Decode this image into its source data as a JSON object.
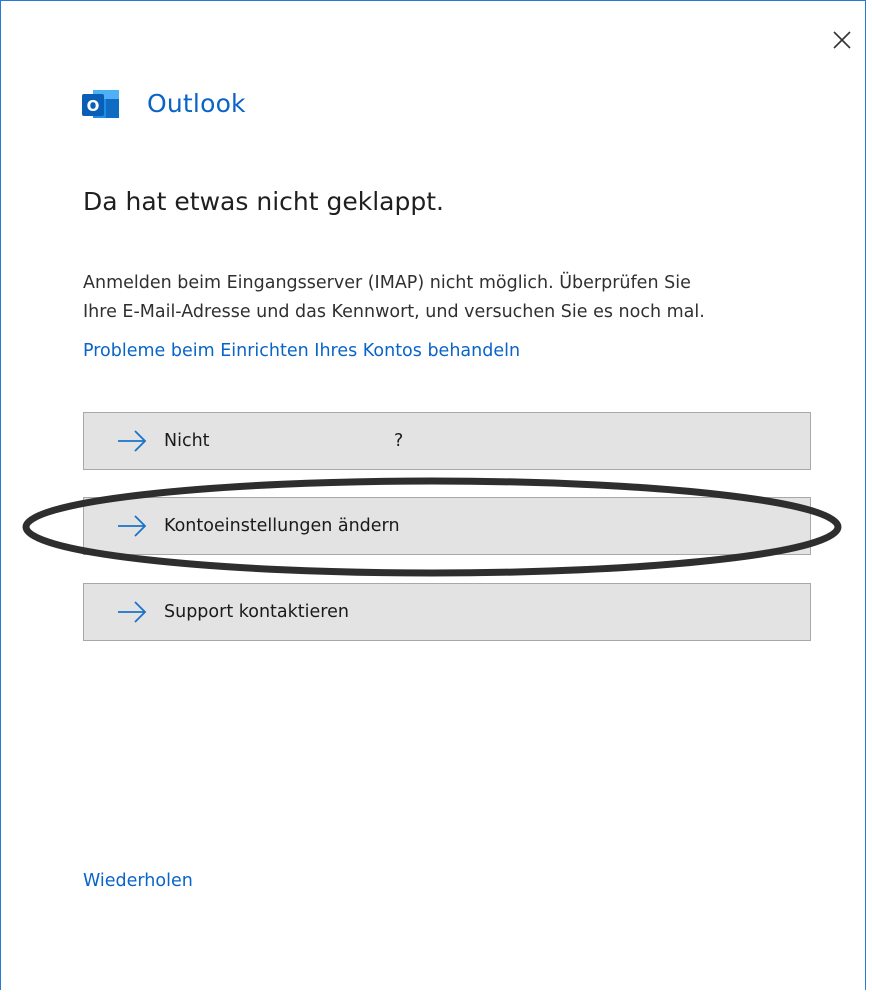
{
  "window": {
    "app_name": "Outlook",
    "close_icon": "close-icon"
  },
  "logo": {
    "icon": "outlook-logo-icon",
    "letter": "O"
  },
  "content": {
    "heading": "Da hat etwas nicht geklappt.",
    "message_line1": "Anmelden beim Eingangsserver (IMAP) nicht möglich. Überprüfen Sie",
    "message_line2": "Ihre E-Mail-Adresse und das Kennwort, und versuchen Sie es noch mal.",
    "help_link": "Probleme beim Einrichten Ihres Kontos behandeln"
  },
  "actions": [
    {
      "label": "Nicht",
      "suffix": "?",
      "icon": "arrow-right-icon"
    },
    {
      "label": "Kontoeinstellungen ändern",
      "icon": "arrow-right-icon"
    },
    {
      "label": "Support kontaktieren",
      "icon": "arrow-right-icon"
    }
  ],
  "footer": {
    "retry_link": "Wiederholen"
  },
  "annotation": {
    "shape": "ellipse",
    "target": "Kontoeinstellungen ändern",
    "color": "#2e2e2e"
  },
  "colors": {
    "accent": "#0a64c8",
    "button_bg": "#e3e3e3",
    "button_border": "#a8a8a8",
    "window_border": "#2b79d6"
  }
}
